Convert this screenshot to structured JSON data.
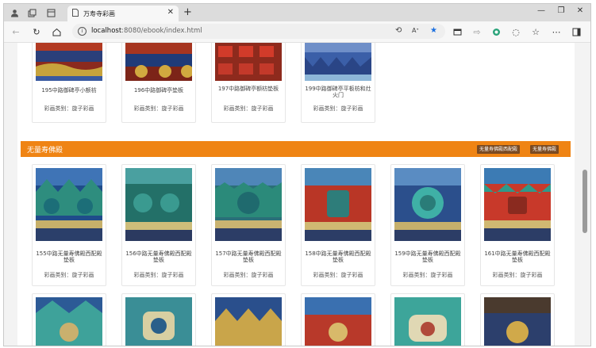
{
  "browser": {
    "tab_title": "万寿寺彩画",
    "url_host": "localhost",
    "url_path": ":8080/ebook/index.html",
    "icons": [
      "profile-icon",
      "workspaces-icon",
      "tab-actions-icon",
      "page-icon",
      "close-icon",
      "plus-icon",
      "minimize-icon",
      "restore-icon",
      "close-window-icon",
      "back-icon",
      "refresh-icon",
      "home-icon",
      "info-icon",
      "translate-icon",
      "read-aloud-icon",
      "favorite-star-icon",
      "split-screen-icon",
      "extensions-icon",
      "copilot-icon",
      "browser-essentials-icon",
      "favorites-icon",
      "more-icon",
      "sidebar-icon"
    ],
    "accent_star": "#1a6fe0"
  },
  "top_cards": [
    {
      "name": "195中路御碑亭小额枋",
      "type": "彩画类别：旋子彩画"
    },
    {
      "name": "196中路御碑亭垫板",
      "type": "彩画类别：旋子彩画"
    },
    {
      "name": "197中路御碑亭额枋垫板",
      "type": "彩画类别：旋子彩画"
    },
    {
      "name": "199中路御碑亭平板枋和灶火门",
      "type": "彩画类别：旋子彩画"
    }
  ],
  "section": {
    "title": "无量寿佛殿",
    "buttons": [
      "无量寿佛殿西配殿",
      "无量寿佛殿"
    ],
    "color": "#ef8414"
  },
  "cards": [
    {
      "name": "155中路无量寿佛殿西配殿垫板",
      "type": "彩画类别：旋子彩画"
    },
    {
      "name": "156中路无量寿佛殿西配殿垫板",
      "type": "彩画类别：旋子彩画"
    },
    {
      "name": "157中路无量寿佛殿西配殿垫板",
      "type": "彩画类别：旋子彩画"
    },
    {
      "name": "158中路无量寿佛殿西配殿垫板",
      "type": "彩画类别：旋子彩画"
    },
    {
      "name": "159中路无量寿佛殿西配殿垫板",
      "type": "彩画类别：旋子彩画"
    },
    {
      "name": "161中路无量寿佛殿西配殿垫板",
      "type": "彩画类别：旋子彩画"
    }
  ]
}
